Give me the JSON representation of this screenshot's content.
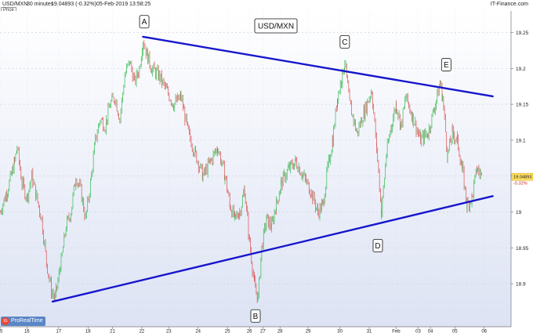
{
  "header": {
    "symbol": "USD/MXN",
    "timeframe": "30 minutes",
    "last_value": "19.04893 (-0.32%)",
    "datetime": "05-Feb-2019 13:58:25",
    "source": "IT-Finance.com"
  },
  "price_tag": "Price",
  "badge": {
    "logo": "IG",
    "text": "ProRealTime"
  },
  "chart_data": {
    "type": "line",
    "title": "USD/MXN",
    "xlabel": "",
    "ylabel": "",
    "ylim": [
      18.84,
      19.28
    ],
    "y_ticks": [
      18.9,
      18.95,
      19,
      19.05,
      19.1,
      19.15,
      19.2,
      19.25
    ],
    "y_tick_labels": [
      "18.9",
      "18.95",
      "19",
      "",
      "19.1",
      "19.15",
      "19.2",
      "19.25"
    ],
    "current_price": {
      "value": 19.04893,
      "label": "19.04893",
      "change": "-0.32%"
    },
    "x_ticks": [
      {
        "label": "15",
        "t": 0
      },
      {
        "label": "16",
        "t": 1.1
      },
      {
        "label": "17",
        "t": 2.4
      },
      {
        "label": "18",
        "t": 3.6
      },
      {
        "label": "21",
        "t": 4.6
      },
      {
        "label": "22",
        "t": 5.8
      },
      {
        "label": "23",
        "t": 6.9
      },
      {
        "label": "24",
        "t": 8.1
      },
      {
        "label": "25",
        "t": 9.3
      },
      {
        "label": "26",
        "t": 10.2
      },
      {
        "label": "27",
        "t": 10.75
      },
      {
        "label": "28",
        "t": 11.45
      },
      {
        "label": "29",
        "t": 12.6
      },
      {
        "label": "30",
        "t": 13.9
      },
      {
        "label": "31",
        "t": 15.1
      },
      {
        "label": "Feb",
        "t": 16.2
      },
      {
        "label": "03",
        "t": 17.1
      },
      {
        "label": "04",
        "t": 17.6
      },
      {
        "label": "05",
        "t": 18.6
      },
      {
        "label": "06",
        "t": 19.8
      }
    ],
    "xlim": [
      0,
      20.9
    ],
    "series": [
      {
        "points": [
          [
            0,
            19.0
          ],
          [
            0.3,
            19.03
          ],
          [
            0.6,
            19.07
          ],
          [
            0.7,
            19.09
          ],
          [
            0.9,
            19.04
          ],
          [
            1.1,
            19.02
          ],
          [
            1.3,
            19.05
          ],
          [
            1.5,
            19.02
          ],
          [
            1.7,
            18.99
          ],
          [
            1.9,
            18.93
          ],
          [
            2.1,
            18.89
          ],
          [
            2.25,
            18.88
          ],
          [
            2.5,
            18.93
          ],
          [
            2.7,
            18.98
          ],
          [
            2.9,
            19.0
          ],
          [
            3.1,
            19.05
          ],
          [
            3.3,
            19.03
          ],
          [
            3.5,
            18.99
          ],
          [
            3.7,
            19.04
          ],
          [
            3.9,
            19.1
          ],
          [
            4.1,
            19.13
          ],
          [
            4.3,
            19.12
          ],
          [
            4.5,
            19.15
          ],
          [
            4.7,
            19.16
          ],
          [
            4.9,
            19.13
          ],
          [
            5.1,
            19.19
          ],
          [
            5.3,
            19.21
          ],
          [
            5.5,
            19.18
          ],
          [
            5.7,
            19.2
          ],
          [
            5.85,
            19.24
          ],
          [
            6.0,
            19.22
          ],
          [
            6.2,
            19.2
          ],
          [
            6.5,
            19.19
          ],
          [
            6.8,
            19.17
          ],
          [
            7.1,
            19.15
          ],
          [
            7.4,
            19.16
          ],
          [
            7.7,
            19.11
          ],
          [
            8.0,
            19.08
          ],
          [
            8.3,
            19.05
          ],
          [
            8.6,
            19.07
          ],
          [
            8.9,
            19.09
          ],
          [
            9.2,
            19.05
          ],
          [
            9.4,
            19.01
          ],
          [
            9.6,
            18.99
          ],
          [
            9.8,
            19.0
          ],
          [
            10.0,
            19.03
          ],
          [
            10.2,
            18.96
          ],
          [
            10.4,
            18.9
          ],
          [
            10.55,
            18.88
          ],
          [
            10.7,
            18.95
          ],
          [
            10.9,
            18.99
          ],
          [
            11.1,
            18.98
          ],
          [
            11.3,
            19.01
          ],
          [
            11.5,
            19.04
          ],
          [
            11.8,
            19.06
          ],
          [
            12.1,
            19.07
          ],
          [
            12.4,
            19.05
          ],
          [
            12.7,
            19.03
          ],
          [
            13.0,
            19.0
          ],
          [
            13.2,
            19.01
          ],
          [
            13.4,
            19.06
          ],
          [
            13.6,
            19.1
          ],
          [
            13.8,
            19.16
          ],
          [
            14.0,
            19.19
          ],
          [
            14.1,
            19.21
          ],
          [
            14.3,
            19.15
          ],
          [
            14.6,
            19.11
          ],
          [
            14.9,
            19.14
          ],
          [
            15.2,
            19.17
          ],
          [
            15.4,
            19.09
          ],
          [
            15.6,
            19.0
          ],
          [
            15.8,
            19.08
          ],
          [
            16.0,
            19.12
          ],
          [
            16.2,
            19.15
          ],
          [
            16.4,
            19.12
          ],
          [
            16.6,
            19.16
          ],
          [
            16.9,
            19.13
          ],
          [
            17.2,
            19.1
          ],
          [
            17.5,
            19.11
          ],
          [
            17.8,
            19.15
          ],
          [
            18.0,
            19.18
          ],
          [
            18.1,
            19.16
          ],
          [
            18.3,
            19.08
          ],
          [
            18.5,
            19.11
          ],
          [
            18.7,
            19.1
          ],
          [
            18.9,
            19.06
          ],
          [
            19.1,
            19.01
          ],
          [
            19.3,
            19.02
          ],
          [
            19.5,
            19.06
          ],
          [
            19.7,
            19.05
          ]
        ]
      }
    ],
    "trendlines": [
      {
        "from": [
          2.15,
          18.875
        ],
        "to": [
          20.15,
          19.022
        ],
        "color": "#1616cc"
      },
      {
        "from": [
          5.85,
          19.244
        ],
        "to": [
          20.15,
          19.161
        ],
        "color": "#1616cc"
      }
    ],
    "annotations": [
      {
        "label": "A",
        "t": 5.9,
        "y": 19.265
      },
      {
        "label": "B",
        "t": 10.45,
        "y": 18.855
      },
      {
        "label": "C",
        "t": 14.1,
        "y": 19.237
      },
      {
        "label": "D",
        "t": 15.45,
        "y": 18.953
      },
      {
        "label": "E",
        "t": 18.25,
        "y": 19.205
      }
    ],
    "colors": {
      "up": "#2db84a",
      "down": "#d64a4a",
      "trend": "#1616cc"
    },
    "grid": true,
    "legend": "none"
  }
}
